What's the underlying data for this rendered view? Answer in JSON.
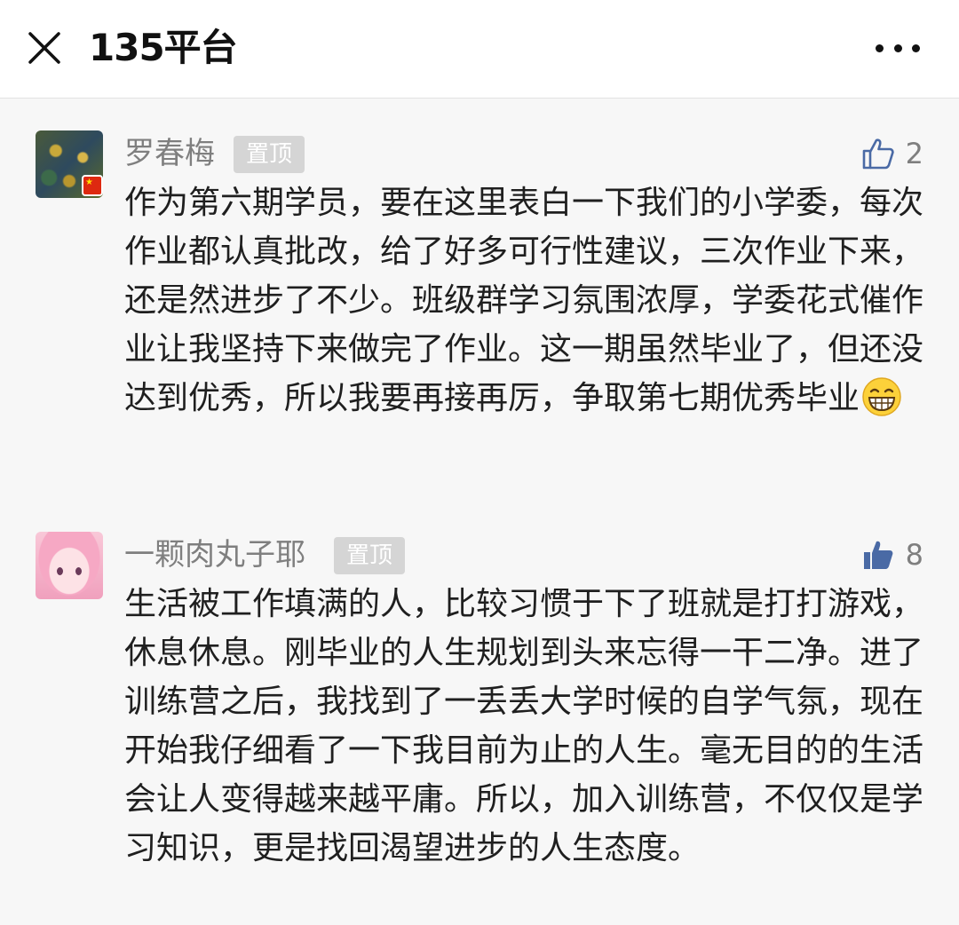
{
  "header": {
    "title": "135平台",
    "close_icon": "close-icon",
    "more_icon": "more-icon"
  },
  "comments": [
    {
      "author": "罗春梅",
      "pin_label": "置顶",
      "like_icon": "thumbs-up-outline-icon",
      "likes": "2",
      "text": "作为第六期学员，要在这里表白一下我们的小学委，每次作业都认真批改，给了好多可行性建议，三次作业下来，还是然进步了不少。班级群学习氛围浓厚，学委花式催作业让我坚持下来做完了作业。这一期虽然毕业了，但还没达到优秀，所以我要再接再厉，争取第七期优秀毕业",
      "emoji": "grinning-face-icon"
    },
    {
      "author": "一颗肉丸子耶",
      "pin_label": "置顶",
      "like_icon": "thumbs-up-filled-icon",
      "likes": "8",
      "text": "生活被工作填满的人，比较习惯于下了班就是打打游戏，休息休息。刚毕业的人生规划到头来忘得一干二净。进了训练营之后，我找到了一丢丢大学时候的自学气氛，现在开始我仔细看了一下我目前为止的人生。毫无目的的生活会让人变得越来越平庸。所以，加入训练营，不仅仅是学习知识，更是找回渴望进步的人生态度。"
    }
  ],
  "colors": {
    "like_filled": "#4a6aa5",
    "like_outline": "#4a6aa5",
    "pin_badge": "#d5d5d5",
    "name": "#7f7f7f",
    "text": "#1f1f1f"
  }
}
